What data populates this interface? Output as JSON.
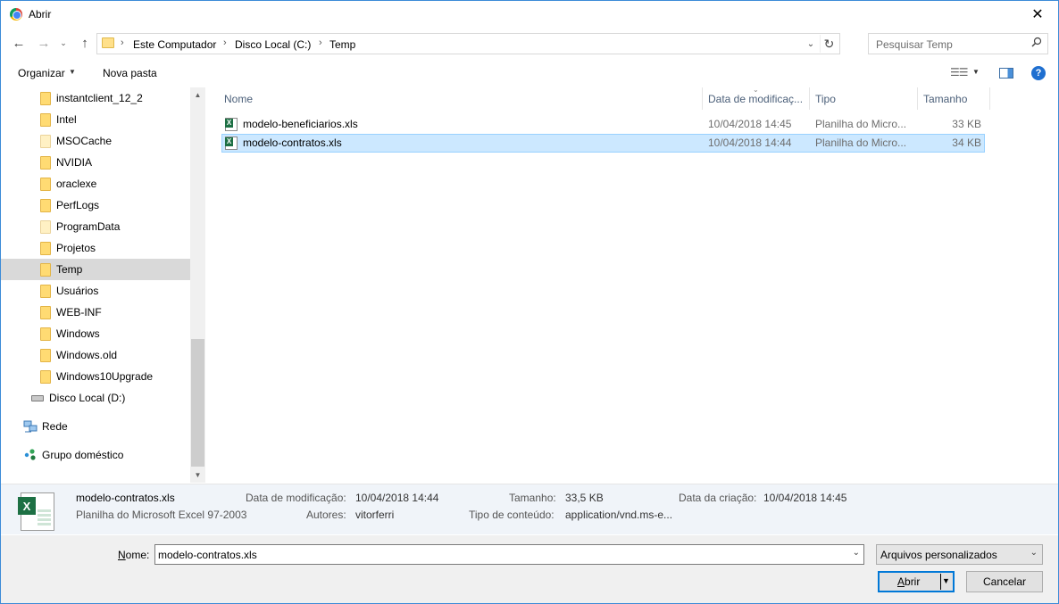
{
  "window": {
    "title": "Abrir",
    "close_glyph": "✕"
  },
  "nav": {
    "back_glyph": "←",
    "forward_glyph": "→",
    "recent_glyph": "⌄",
    "up_glyph": "↑",
    "breadcrumbs": [
      "Este Computador",
      "Disco Local (C:)",
      "Temp"
    ],
    "separator_glyph": "›",
    "dropdown_glyph": "⌄",
    "refresh_glyph": "↻"
  },
  "search": {
    "placeholder": "Pesquisar Temp"
  },
  "toolbar": {
    "organize_label": "Organizar",
    "new_folder_label": "Nova pasta",
    "help_glyph": "?"
  },
  "sidebar": {
    "folders": [
      {
        "label": "instantclient_12_2"
      },
      {
        "label": "Intel"
      },
      {
        "label": "MSOCache"
      },
      {
        "label": "NVIDIA"
      },
      {
        "label": "oraclexe"
      },
      {
        "label": "PerfLogs"
      },
      {
        "label": "ProgramData"
      },
      {
        "label": "Projetos"
      },
      {
        "label": "Temp",
        "selected": true
      },
      {
        "label": "Usuários"
      },
      {
        "label": "WEB-INF"
      },
      {
        "label": "Windows"
      },
      {
        "label": "Windows.old"
      },
      {
        "label": "Windows10Upgrade"
      }
    ],
    "drive_label": "Disco Local (D:)",
    "network_label": "Rede",
    "homegroup_label": "Grupo doméstico"
  },
  "filelist": {
    "columns": {
      "name": "Nome",
      "date": "Data de modificaç...",
      "type": "Tipo",
      "size": "Tamanho"
    },
    "rows": [
      {
        "name": "modelo-beneficiarios.xls",
        "date": "10/04/2018 14:45",
        "type": "Planilha do Micro...",
        "size": "33 KB",
        "selected": false
      },
      {
        "name": "modelo-contratos.xls",
        "date": "10/04/2018 14:44",
        "type": "Planilha do Micro...",
        "size": "34 KB",
        "selected": true
      }
    ]
  },
  "details": {
    "file_name": "modelo-contratos.xls",
    "file_type": "Planilha do Microsoft Excel 97-2003",
    "modified_label": "Data de modificação:",
    "modified_value": "10/04/2018 14:44",
    "authors_label": "Autores:",
    "authors_value": "vitorferri",
    "size_label": "Tamanho:",
    "size_value": "33,5 KB",
    "content_type_label": "Tipo de conteúdo:",
    "content_type_value": "application/vnd.ms-e...",
    "created_label": "Data da criação:",
    "created_value": "10/04/2018 14:45"
  },
  "bottom": {
    "name_label_prefix": "N",
    "name_label_rest": "ome:",
    "name_value": "modelo-contratos.xls",
    "filter_value": "Arquivos personalizados",
    "open_label_prefix": "A",
    "open_label_rest": "brir",
    "cancel_label": "Cancelar"
  },
  "colors": {
    "selection_bg": "#cce8ff",
    "selection_border": "#99d1ff",
    "accent": "#0078d7",
    "excel_green": "#1d7044"
  }
}
